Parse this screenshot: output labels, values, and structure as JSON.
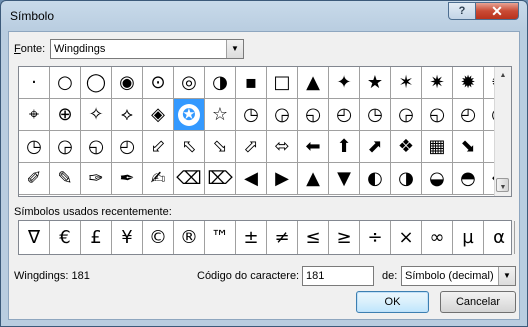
{
  "window": {
    "title": "Símbolo",
    "help_label": "?",
    "close_label": "✕"
  },
  "font": {
    "label_prefix": "F",
    "label_rest": "onte:",
    "value": "Wingdings"
  },
  "grid": {
    "rows": [
      [
        "·",
        "○",
        "◯",
        "◉",
        "⊙",
        "◎",
        "◑",
        "▪",
        "□",
        "▲",
        "✦",
        "★",
        "✶",
        "✷",
        "✹",
        "✺"
      ],
      [
        "⌖",
        "⊕",
        "✧",
        "⟡",
        "◈",
        "✪",
        "☆",
        "◷",
        "◶",
        "◵",
        "◴",
        "◷",
        "◶",
        "◵",
        "◴",
        "◷"
      ],
      [
        "◷",
        "◶",
        "◵",
        "◴",
        "⬃",
        "⬁",
        "⬂",
        "⬀",
        "⬄",
        "⬅",
        "⬆",
        "⬈",
        "❖",
        "▦",
        "⬊",
        "⬋"
      ],
      [
        "✐",
        "✎",
        "✑",
        "✒",
        "✍",
        "⌫",
        "⌦",
        "◀",
        "▶",
        "▲",
        "▼",
        "◐",
        "◑",
        "◒",
        "◓",
        "←"
      ]
    ],
    "selected_char": "✪"
  },
  "recent": {
    "label": "Símbolos usados recentemente:",
    "chars": [
      "∇",
      "€",
      "£",
      "¥",
      "©",
      "®",
      "™",
      "±",
      "≠",
      "≤",
      "≥",
      "÷",
      "×",
      "∞",
      "µ",
      "α"
    ]
  },
  "status": {
    "text": "Wingdings: 181"
  },
  "code": {
    "label": "Código do caractere:",
    "value": "181"
  },
  "from": {
    "label": "de:",
    "value": "Símbolo (decimal)"
  },
  "buttons": {
    "ok": "OK",
    "cancel": "Cancelar"
  }
}
